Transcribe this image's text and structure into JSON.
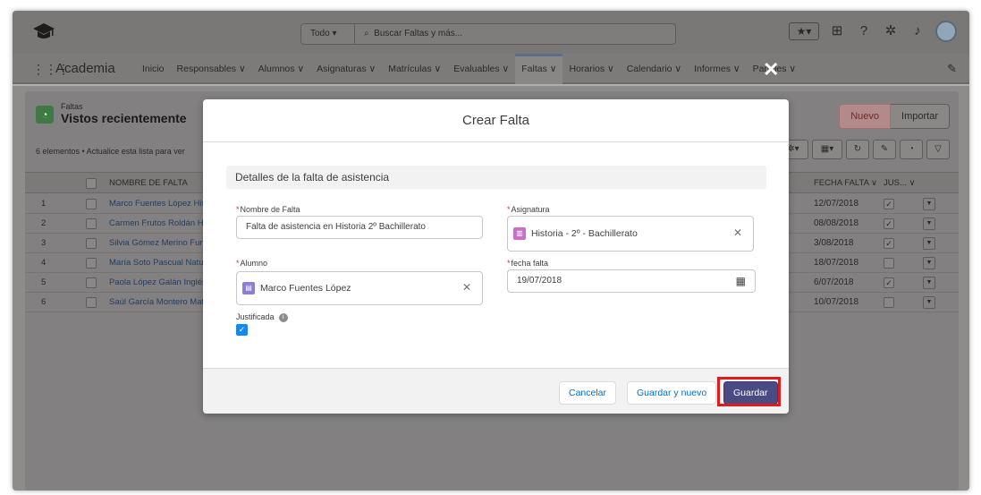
{
  "header": {
    "search_scope": "Todo",
    "search_placeholder": "Buscar Faltas y más...",
    "icons": [
      "favorites-icon",
      "add-icon",
      "help-icon",
      "setup-gear-icon",
      "notifications-bell-icon",
      "avatar"
    ]
  },
  "nav": {
    "app_name": "Academia",
    "items": [
      {
        "label": "Inicio"
      },
      {
        "label": "Responsables ∨"
      },
      {
        "label": "Alumnos ∨"
      },
      {
        "label": "Asignaturas ∨"
      },
      {
        "label": "Matrículas ∨"
      },
      {
        "label": "Evaluables ∨"
      },
      {
        "label": "Faltas ∨",
        "active": true
      },
      {
        "label": "Horarios ∨"
      },
      {
        "label": "Calendario ∨"
      },
      {
        "label": "Informes ∨"
      },
      {
        "label": "Paneles ∨"
      }
    ]
  },
  "list": {
    "object_label": "Faltas",
    "title": "Vistos recientemente",
    "meta": "6 elementos • Actualice esta lista para ver",
    "buttons": {
      "new": "Nuevo",
      "import": "Importar"
    },
    "columns": {
      "name": "NOMBRE DE FALTA",
      "date": "FECHA FALTA ∨",
      "justified": "JUS... ∨"
    },
    "rows": [
      {
        "num": "1",
        "name": "Marco Fuentes López His",
        "date": "12/07/2018",
        "justified": true
      },
      {
        "num": "2",
        "name": "Carmen Frutos Roldán H",
        "date": "08/08/2018",
        "justified": true
      },
      {
        "num": "3",
        "name": "Silvia Gómez Merino Fun",
        "date": "3/08/2018",
        "justified": true
      },
      {
        "num": "4",
        "name": "María Soto Pascual Natur",
        "date": "18/07/2018",
        "justified": false
      },
      {
        "num": "5",
        "name": "Paola López Galán Inglés",
        "date": "6/07/2018",
        "justified": true
      },
      {
        "num": "6",
        "name": "Saúl García Montero Mat",
        "date": "10/07/2018",
        "justified": false
      }
    ]
  },
  "modal": {
    "title": "Crear Falta",
    "section": "Detalles de la falta de asistencia",
    "fields": {
      "nombre": {
        "label": "Nombre de Falta",
        "value": "Falta de asistencia en Historia 2º Bachillerato"
      },
      "asignatura": {
        "label": "Asignatura",
        "value": "Historia - 2º - Bachillerato"
      },
      "alumno": {
        "label": "Alumno",
        "value": "Marco Fuentes López"
      },
      "fecha": {
        "label": "fecha falta",
        "value": "19/07/2018"
      },
      "justificada": {
        "label": "Justificada",
        "checked": true
      }
    },
    "required_mark": "*",
    "buttons": {
      "cancel": "Cancelar",
      "save_new": "Guardar y nuevo",
      "save": "Guardar"
    }
  },
  "colors": {
    "primary_button": "#4a4a84",
    "highlight_ring": "#e01b1b",
    "checkbox": "#1589ee",
    "object_icon": "#3f7a44"
  }
}
